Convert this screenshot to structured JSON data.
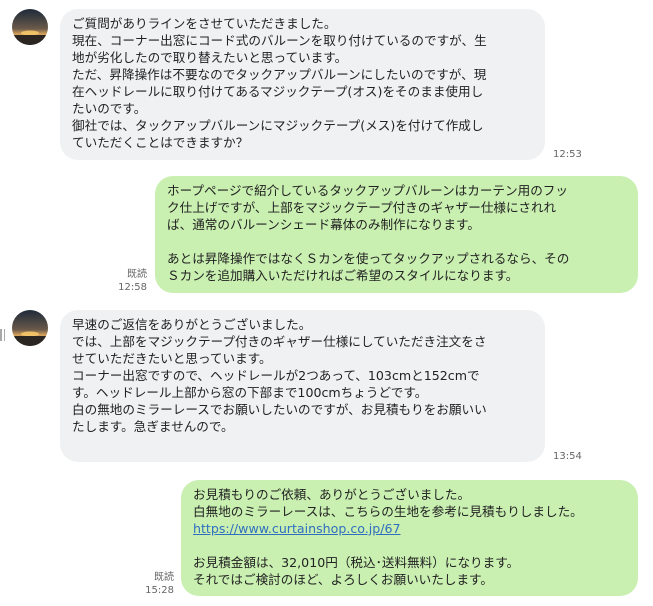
{
  "messages": [
    {
      "id": "m1",
      "direction": "in",
      "lines": [
        "ご質問がありラインをさせていただきました。",
        "現在、コーナー出窓にコード式のバルーンを取り付けているのですが、生",
        "地が劣化したので取り替えたいと思っています。",
        "ただ、昇降操作は不要なのでタックアップバルーンにしたいのですが、現",
        "在ヘッドレールに取り付けてあるマジックテープ(オス)をそのまま使用し",
        "たいのです。",
        "御社では、タックアップバルーンにマジックテープ(メス)を付けて作成し",
        "ていただくことはできますか？"
      ],
      "time": "12:53"
    },
    {
      "id": "m2",
      "direction": "out",
      "lines": [
        "ホープページで紹介しているタックアップバルーンはカーテン用のフッ",
        "ク仕上げですが、上部をマジックテープ付きのギャザー仕様にされれ",
        "ば、通常のバルーンシェード幕体のみ制作になります。",
        "",
        "あとは昇降操作ではなくＳカンを使ってタックアップされるなら、その",
        "Ｓカンを追加購入いただければご希望のスタイルになります。"
      ],
      "read": "既読",
      "time": "12:58"
    },
    {
      "id": "m3",
      "direction": "in",
      "lines": [
        "早速のご返信をありがとうございました。",
        "では、上部をマジックテープ付きのギャザー仕様にしていただき注文をさ",
        "せていただきたいと思っています。",
        "コーナー出窓ですので、ヘッドレールが2つあって、103cmと152cmで",
        "す。ヘッドレール上部から窓の下部まで100cmちょうどです。",
        "白の無地のミラーレースでお願いしたいのですが、お見積もりをお願いい",
        "たします。急ぎませんので。"
      ],
      "time": "13:54"
    },
    {
      "id": "m4",
      "direction": "out",
      "lines": [
        "お見積もりのご依頼、ありがとうございました。",
        "白無地のミラーレースは、こちらの生地を参考に見積もりしました。"
      ],
      "link": "https://www.curtainshop.co.jp/67",
      "lines_after": [
        "",
        "お見積金額は、32,010円（税込･送料無料）になります。",
        "それではご検討のほど、よろしくお願いいたします。"
      ],
      "read": "既読",
      "time": "15:28"
    }
  ],
  "colors": {
    "incoming_bubble": "#eff1f3",
    "outgoing_bubble": "#c9efb1",
    "link": "#2f6fbf",
    "timestamp": "#666666"
  },
  "icons": {
    "avatar": "sunset-avatar",
    "resize_handle": "grip-handle-icon"
  }
}
